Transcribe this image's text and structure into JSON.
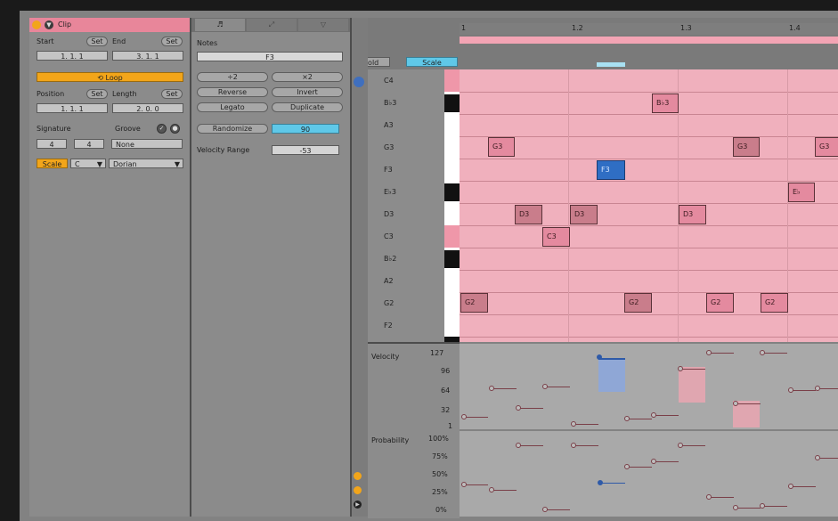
{
  "clip": {
    "title": "Clip",
    "start_label": "Start",
    "end_label": "End",
    "set_label": "Set",
    "start_value": "1.   1.   1",
    "end_value": "3.   1.   1",
    "loop_label": "Loop",
    "position_label": "Position",
    "length_label": "Length",
    "position_value": "1.   1.   1",
    "length_value": "2.   0.   0",
    "signature_label": "Signature",
    "groove_label": "Groove",
    "sig_num": "4",
    "sig_den": "4",
    "groove_value": "None",
    "scale_label": "Scale",
    "scale_root": "C",
    "scale_mode": "Dorian"
  },
  "notes_panel": {
    "notes_label": "Notes",
    "note_value": "F3",
    "btn_div2": "÷2",
    "btn_mul2": "×2",
    "btn_reverse": "Reverse",
    "btn_invert": "Invert",
    "btn_legato": "Legato",
    "btn_duplicate": "Duplicate",
    "btn_randomize": "Randomize",
    "randomize_value": "90",
    "velocity_range_label": "Velocity Range",
    "velocity_range_value": "-53"
  },
  "roll": {
    "fold_label": "Fold",
    "scale_label": "Scale",
    "ruler": [
      "1",
      "1.2",
      "1.3",
      "1.4"
    ],
    "key_names": [
      "C4",
      "B♭3",
      "A3",
      "G3",
      "F3",
      "E♭3",
      "D3",
      "C3",
      "B♭2",
      "A2",
      "G2",
      "F2"
    ]
  },
  "lanes": {
    "velocity_label": "Velocity",
    "velocity_ticks": [
      "127",
      "96",
      "64",
      "32",
      "1"
    ],
    "probability_label": "Probability",
    "probability_ticks": [
      "100%",
      "75%",
      "50%",
      "25%",
      "0%"
    ]
  },
  "colors": {
    "accent": "#f2a51a",
    "note": "#e48a9f",
    "selected": "#2f6ec4",
    "scale": "#5fc8e8"
  }
}
